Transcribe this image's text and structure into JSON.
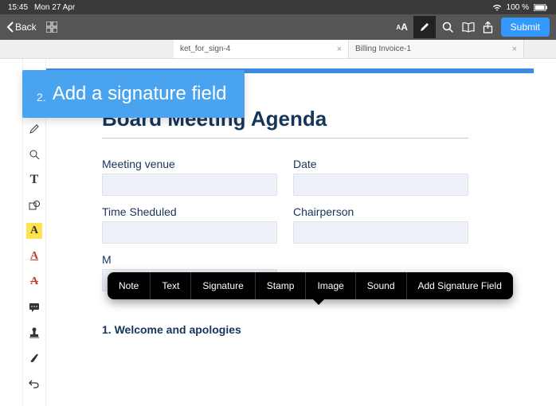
{
  "status": {
    "time": "15:45",
    "date": "Mon 27 Apr",
    "battery": "100 %"
  },
  "toolbar": {
    "back": "Back",
    "submit": "Submit"
  },
  "tabs": [
    {
      "label": "ket_for_sign-4",
      "active": true
    },
    {
      "label": "Billing Invoice-1",
      "active": false
    }
  ],
  "callout": {
    "number": "2.",
    "text": "Add a signature field"
  },
  "document": {
    "title": "Board Meeting Agenda",
    "fields": {
      "venue_label": "Meeting venue",
      "date_label": "Date",
      "time_label": "Time Sheduled",
      "chair_label": "Chairperson",
      "minute_label": "M"
    },
    "agenda_item1": "1.   Welcome and apologies"
  },
  "context_menu": {
    "note": "Note",
    "text": "Text",
    "signature": "Signature",
    "stamp": "Stamp",
    "image": "Image",
    "sound": "Sound",
    "add_sig_field": "Add Signature Field"
  }
}
